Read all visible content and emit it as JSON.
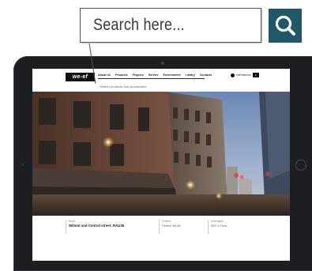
{
  "search": {
    "placeholder": "Search here...",
    "button_icon": "magnifier-icon"
  },
  "colors": {
    "search_button": "#1f5869",
    "tablet_frame": "#1d1e22"
  },
  "site": {
    "logo": "we-ef",
    "nav": [
      "About Us",
      "Products",
      "Projects",
      "Service",
      "Environment",
      "Library",
      "Contacts"
    ],
    "international": "International",
    "subsearch": "→ Search products and accessories",
    "caption": {
      "col1_label": "News",
      "col1_value": "Wilmot and Central street; RAU36",
      "col2_label": "Projects",
      "col2_value": "Flexible RAU36",
      "col3_label": "Downloads",
      "col3_value": "WEF & Press"
    }
  }
}
